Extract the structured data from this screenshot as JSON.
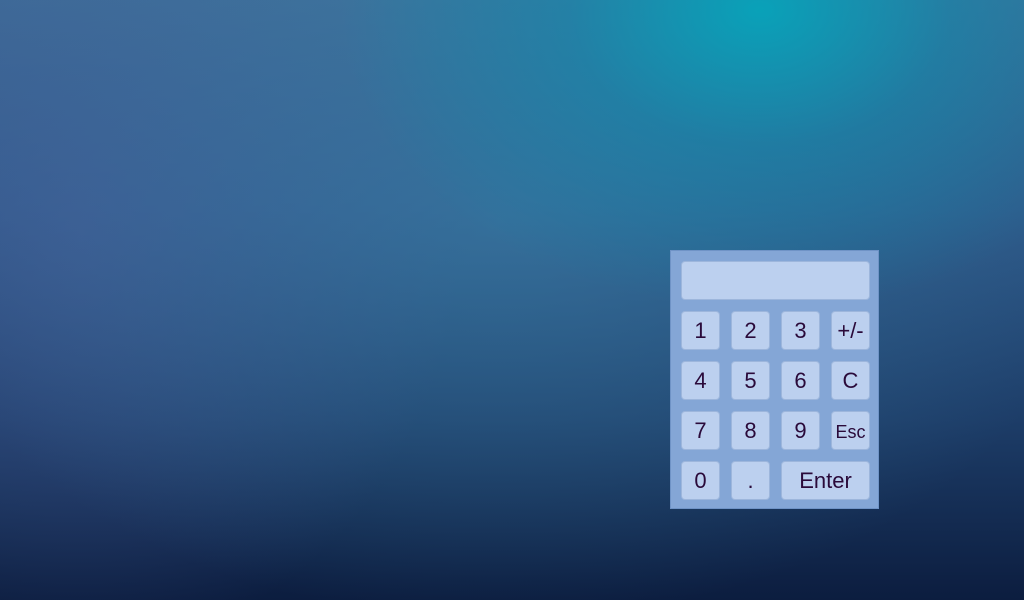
{
  "desktop": {
    "background_colors": [
      "#3c6e98",
      "#0aa7bd",
      "#1d3d68",
      "#0c1d3f"
    ]
  },
  "keypad": {
    "display_value": "",
    "panel_color": "#84a6d6",
    "key_color": "#bcd0ef",
    "text_color": "#2a0a3a",
    "keys": {
      "one": "1",
      "two": "2",
      "three": "3",
      "plus_minus": "+/-",
      "four": "4",
      "five": "5",
      "six": "6",
      "clear": "C",
      "seven": "7",
      "eight": "8",
      "nine": "9",
      "escape": "Esc",
      "zero": "0",
      "decimal": ".",
      "enter": "Enter"
    }
  }
}
